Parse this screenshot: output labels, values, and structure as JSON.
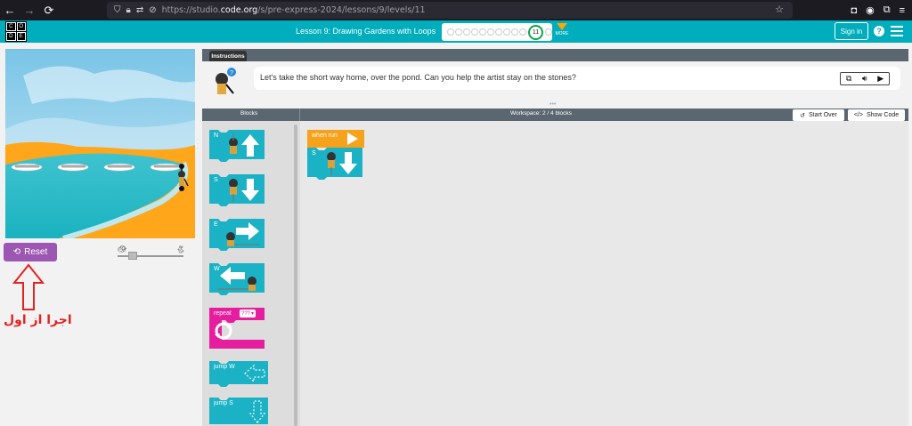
{
  "browser": {
    "url_prefix": "https://studio.",
    "url_host": "code.org",
    "url_path": "/s/pre-express-2024/lessons/9/levels/11"
  },
  "header": {
    "logo_letters": [
      "C",
      "O",
      "D",
      "E"
    ],
    "lesson_title": "Lesson 9: Drawing Gardens with Loops",
    "current_level": "11",
    "more_label": "MORE",
    "sign_in": "Sign in",
    "help_glyph": "?"
  },
  "instructions": {
    "tab_label": "Instructions",
    "text": "Let's take the short way home, over the pond. Can you help the artist stay on the stones?"
  },
  "visualization": {
    "reset_label": "Reset",
    "annotation": "اجرا از اول"
  },
  "toolbox": {
    "header": "Blocks",
    "blocks": {
      "north": "N",
      "south": "S",
      "east": "E",
      "west": "W",
      "repeat": "repeat",
      "repeat_value": "???",
      "jump_w": "jump  W",
      "jump_s": "jump  S"
    }
  },
  "workspace": {
    "header": "Workspace: 2 / 4 blocks",
    "start_over": "Start Over",
    "show_code": "Show Code",
    "when_run": "when run",
    "placed_south": "S"
  },
  "colors": {
    "header_teal": "#00adbc",
    "block_teal": "#1ab2c4",
    "repeat_pink": "#e71d9f",
    "event_orange": "#f6a21b",
    "reset_purple": "#9c57b2",
    "annotation_red": "#e32222"
  }
}
